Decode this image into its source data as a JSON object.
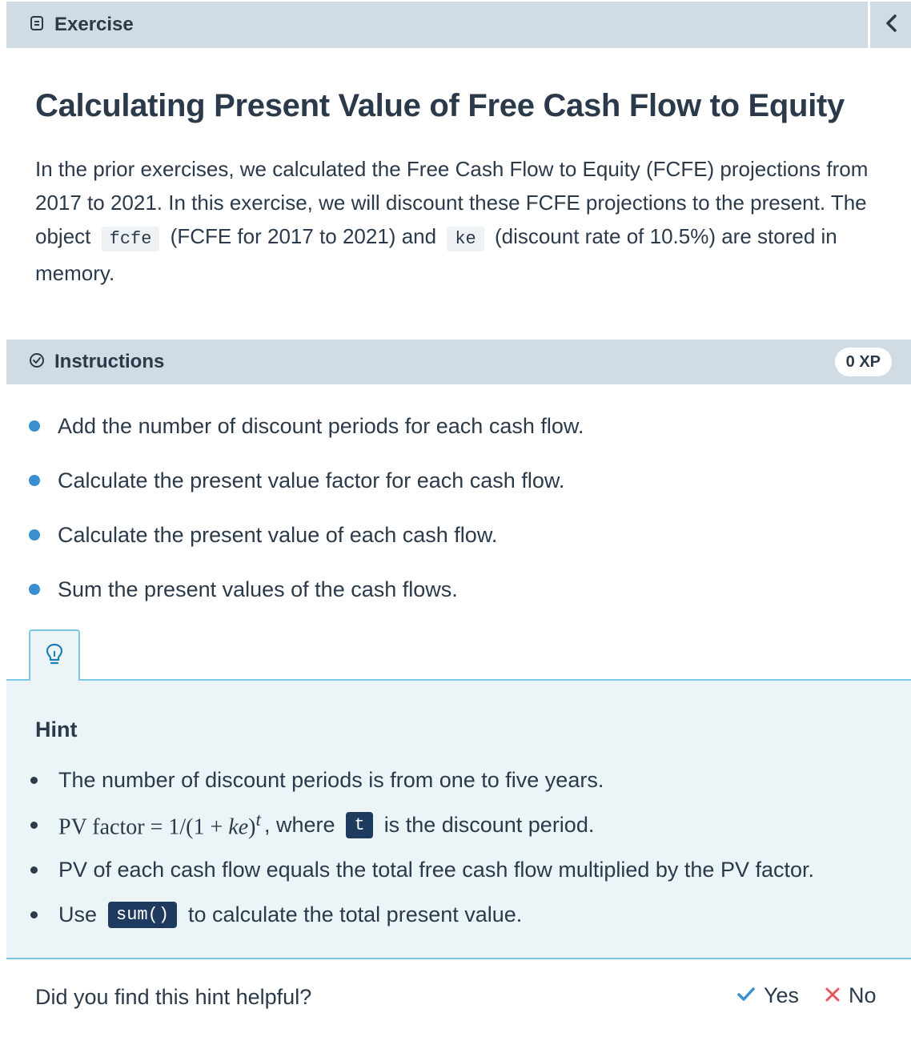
{
  "header": {
    "label": "Exercise",
    "icon": "document-icon",
    "collapse_icon": "chevron-left-icon"
  },
  "exercise": {
    "title": "Calculating Present Value of Free Cash Flow to Equity",
    "intro_1": "In the prior exercises, we calculated the Free Cash Flow to Equity (FCFE) projections from 2017 to 2021. In this exercise, we will discount these FCFE projections to the present. The object",
    "code_fcfe": "fcfe",
    "intro_2": "(FCFE for 2017 to 2021) and",
    "code_ke": "ke",
    "intro_3": "(discount rate of 10.5%) are stored in memory."
  },
  "instructions": {
    "label": "Instructions",
    "xp": "0 XP",
    "steps": [
      "Add the number of discount periods for each cash flow.",
      "Calculate the present value factor for each cash flow.",
      "Calculate the present value of each cash flow.",
      "Sum the present values of the cash flows."
    ]
  },
  "hint": {
    "title": "Hint",
    "item_1": "The number of discount periods is from one to five years.",
    "item_2_math_a": "PV factor = 1/(1 + ",
    "item_2_math_ke": "ke",
    "item_2_math_b": ")",
    "item_2_math_sup": "t",
    "item_2_text_a": ", where",
    "item_2_code": "t",
    "item_2_text_b": "is the discount period.",
    "item_3": "PV of each cash flow equals the total free cash flow multiplied by the PV factor.",
    "item_4_text_a": "Use",
    "item_4_code": "sum()",
    "item_4_text_b": "to calculate the total present value."
  },
  "feedback": {
    "question": "Did you find this hint helpful?",
    "yes": "Yes",
    "no": "No",
    "yes_color": "#3a8fd1",
    "no_color": "#e8555d"
  }
}
